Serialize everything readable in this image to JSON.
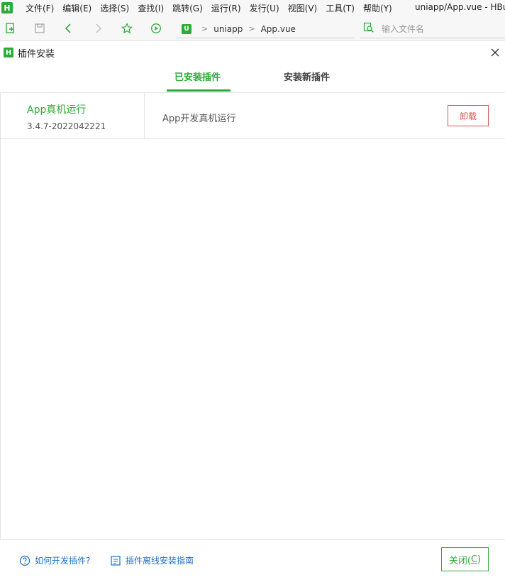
{
  "menubar": {
    "logo_letter": "H",
    "items": [
      "文件(F)",
      "编辑(E)",
      "选择(S)",
      "查找(I)",
      "跳转(G)",
      "运行(R)",
      "发行(U)",
      "视图(V)",
      "工具(T)",
      "帮助(Y)"
    ],
    "window_title": "uniapp/App.vue - HBu"
  },
  "toolbar": {
    "breadcrumb": {
      "badge_letter": "U",
      "project": "uniapp",
      "file": "App.vue"
    },
    "file_search_placeholder": "输入文件名"
  },
  "dialog": {
    "logo_letter": "H",
    "title": "插件安装",
    "tabs": [
      {
        "label": "已安装插件",
        "active": true
      },
      {
        "label": "安装新插件",
        "active": false
      }
    ],
    "plugins": [
      {
        "name": "App真机运行",
        "version": "3.4.7-2022042221",
        "description": "App开发真机运行",
        "uninstall_label": "卸载"
      }
    ],
    "footer": {
      "help_link": "如何开发插件?",
      "offline_guide_link": "插件离线安装指南",
      "close_label": "关闭(",
      "close_mnemonic": "C",
      "close_suffix": ")"
    }
  },
  "colors": {
    "accent": "#2eaa3a",
    "danger": "#d9534f",
    "link": "#1a6fc7"
  }
}
